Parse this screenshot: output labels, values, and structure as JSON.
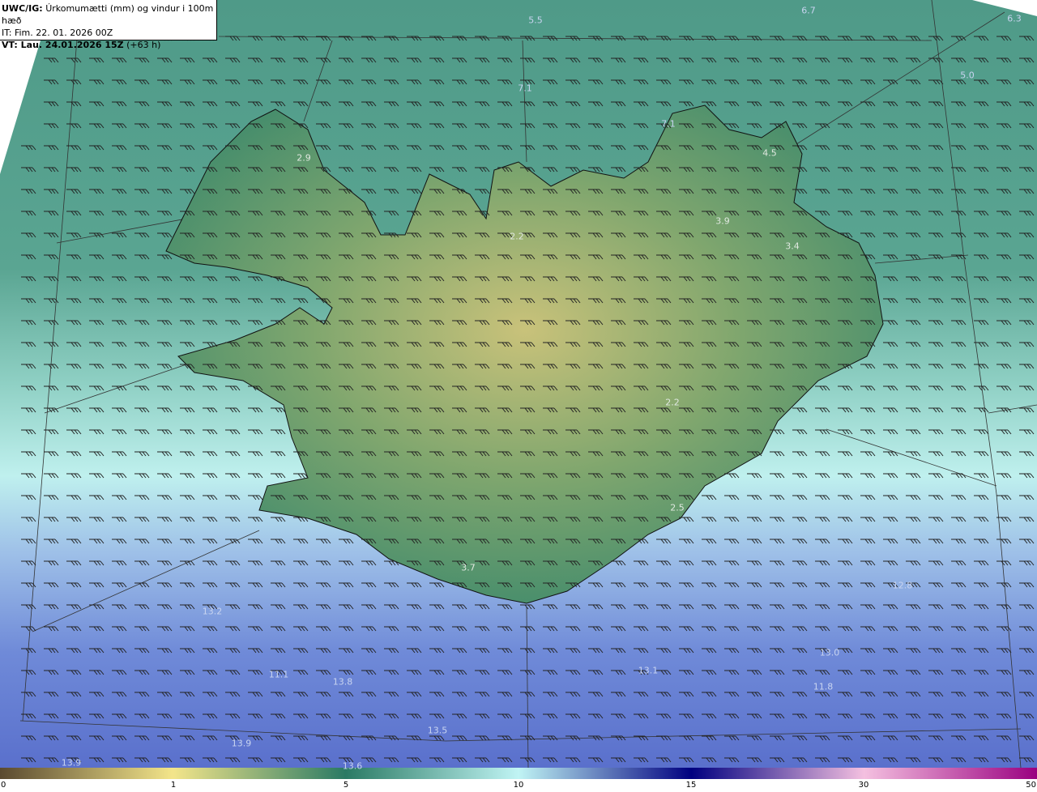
{
  "header": {
    "model": "UWC/IG:",
    "title": "Úrkomumætti (mm) og vindur i 100m hæð",
    "issue_time": "IT: Fim. 22. 01. 2026 00Z",
    "valid_label": "VT: Lau. 24.01.2026 15Z",
    "valid_offset": "(+63 h)"
  },
  "map_values": [
    {
      "text": "5.5",
      "zone": "sea"
    },
    {
      "text": "6.7",
      "zone": "sea"
    },
    {
      "text": "6.3",
      "zone": "sea"
    },
    {
      "text": "5.0",
      "zone": "sea"
    },
    {
      "text": "7.1",
      "zone": "sea"
    },
    {
      "text": "7.1",
      "zone": "sea"
    },
    {
      "text": "2.9",
      "zone": "land"
    },
    {
      "text": "4.5",
      "zone": "land"
    },
    {
      "text": "3.9",
      "zone": "land"
    },
    {
      "text": "2.2",
      "zone": "land"
    },
    {
      "text": "3.4",
      "zone": "land"
    },
    {
      "text": "2.2",
      "zone": "land"
    },
    {
      "text": "2.5",
      "zone": "land"
    },
    {
      "text": "3.7",
      "zone": "land"
    },
    {
      "text": "12.8",
      "zone": "sea"
    },
    {
      "text": "13.2",
      "zone": "sea"
    },
    {
      "text": "13.0",
      "zone": "sea"
    },
    {
      "text": "13.1",
      "zone": "sea"
    },
    {
      "text": "11.1",
      "zone": "sea"
    },
    {
      "text": "13.8",
      "zone": "sea"
    },
    {
      "text": "11.8",
      "zone": "sea"
    },
    {
      "text": "13.5",
      "zone": "sea"
    },
    {
      "text": "13.9",
      "zone": "sea"
    },
    {
      "text": "13.9",
      "zone": "sea"
    },
    {
      "text": "13.6",
      "zone": "sea"
    }
  ],
  "colorbar": {
    "ticks": [
      "0",
      "1",
      "5",
      "10",
      "15",
      "30",
      "50"
    ],
    "colors": [
      "#5a4a30",
      "#f3e58a",
      "#2a7a64",
      "#c0f4f4",
      "#000080",
      "#f4c0e0",
      "#9a0080"
    ]
  }
}
